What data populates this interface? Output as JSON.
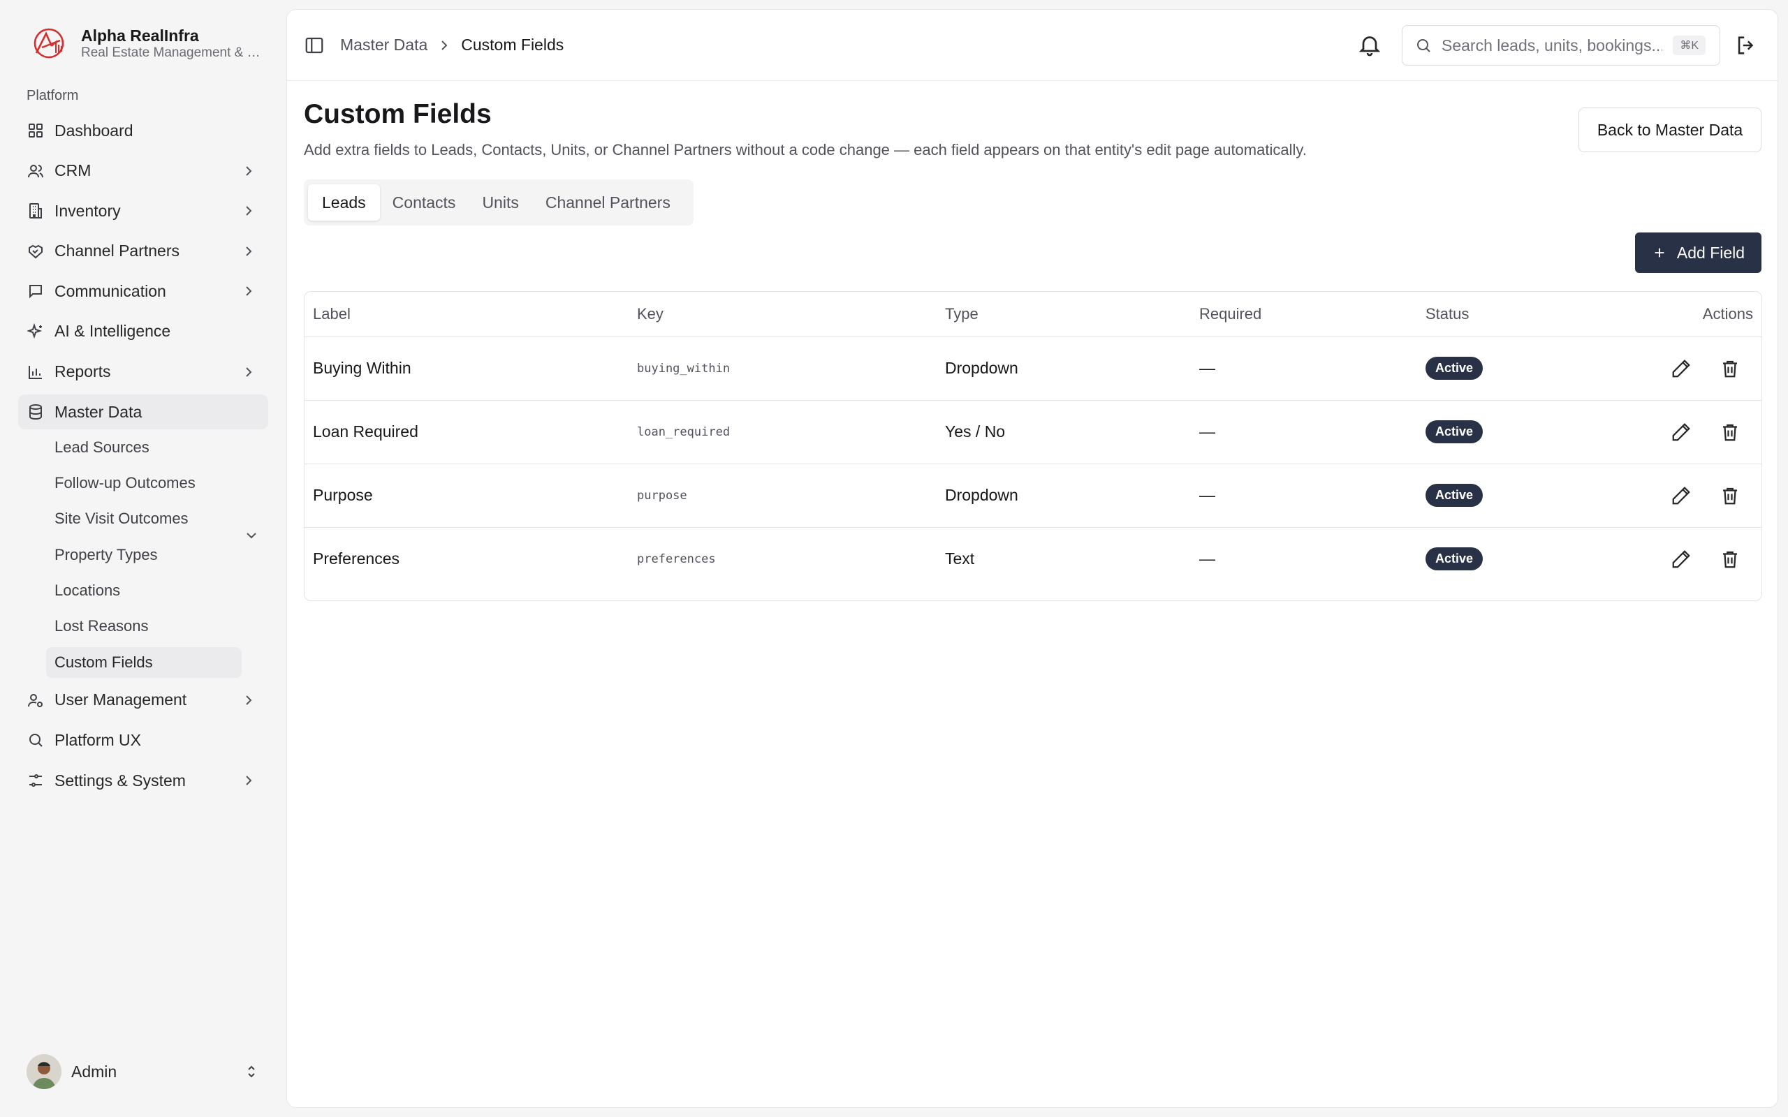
{
  "brand": {
    "name": "Alpha RealInfra",
    "subtitle": "Real Estate Management & Sales",
    "logo_color": "#d62e2e"
  },
  "sidebar": {
    "group_label": "Platform",
    "items": [
      {
        "label": "Dashboard",
        "icon": "grid-icon",
        "chevron": false
      },
      {
        "label": "CRM",
        "icon": "users-icon",
        "chevron": true
      },
      {
        "label": "Inventory",
        "icon": "building-icon",
        "chevron": true
      },
      {
        "label": "Channel Partners",
        "icon": "handshake-icon",
        "chevron": true
      },
      {
        "label": "Communication",
        "icon": "message-icon",
        "chevron": true
      },
      {
        "label": "AI & Intelligence",
        "icon": "sparkles-icon",
        "chevron": false
      },
      {
        "label": "Reports",
        "icon": "bar-chart-icon",
        "chevron": true
      },
      {
        "label": "Master Data",
        "icon": "database-icon",
        "chevron": false,
        "active": true
      },
      {
        "label": "User Management",
        "icon": "user-cog-icon",
        "chevron": true
      },
      {
        "label": "Platform UX",
        "icon": "search-icon",
        "chevron": false
      },
      {
        "label": "Settings & System",
        "icon": "sliders-icon",
        "chevron": true
      }
    ],
    "master_data_children": [
      {
        "label": "Lead Sources"
      },
      {
        "label": "Follow-up Outcomes"
      },
      {
        "label": "Site Visit Outcomes"
      },
      {
        "label": "Property Types"
      },
      {
        "label": "Locations"
      },
      {
        "label": "Lost Reasons"
      },
      {
        "label": "Custom Fields",
        "active": true
      }
    ],
    "user": {
      "name": "Admin"
    }
  },
  "topbar": {
    "breadcrumb": [
      "Master Data",
      "Custom Fields"
    ],
    "search_placeholder": "Search leads, units, bookings...",
    "search_shortcut": "⌘K"
  },
  "page": {
    "title": "Custom Fields",
    "subtitle": "Add extra fields to Leads, Contacts, Units, or Channel Partners without a code change — each field appears on that entity's edit page automatically.",
    "back_button": "Back to Master Data",
    "add_button": "Add Field",
    "tabs": [
      {
        "label": "Leads",
        "active": true
      },
      {
        "label": "Contacts"
      },
      {
        "label": "Units"
      },
      {
        "label": "Channel Partners"
      }
    ]
  },
  "table": {
    "columns": [
      "Label",
      "Key",
      "Type",
      "Required",
      "Status",
      "Actions"
    ],
    "rows": [
      {
        "label": "Buying Within",
        "key": "buying_within",
        "type": "Dropdown",
        "required": "—",
        "status": "Active"
      },
      {
        "label": "Loan Required",
        "key": "loan_required",
        "type": "Yes / No",
        "required": "—",
        "status": "Active"
      },
      {
        "label": "Purpose",
        "key": "purpose",
        "type": "Dropdown",
        "required": "—",
        "status": "Active"
      },
      {
        "label": "Preferences",
        "key": "preferences",
        "type": "Text",
        "required": "—",
        "status": "Active"
      }
    ]
  },
  "colors": {
    "accent_dark": "#283145",
    "active_bg": "#ebebed",
    "page_bg": "#f5f5f5"
  }
}
